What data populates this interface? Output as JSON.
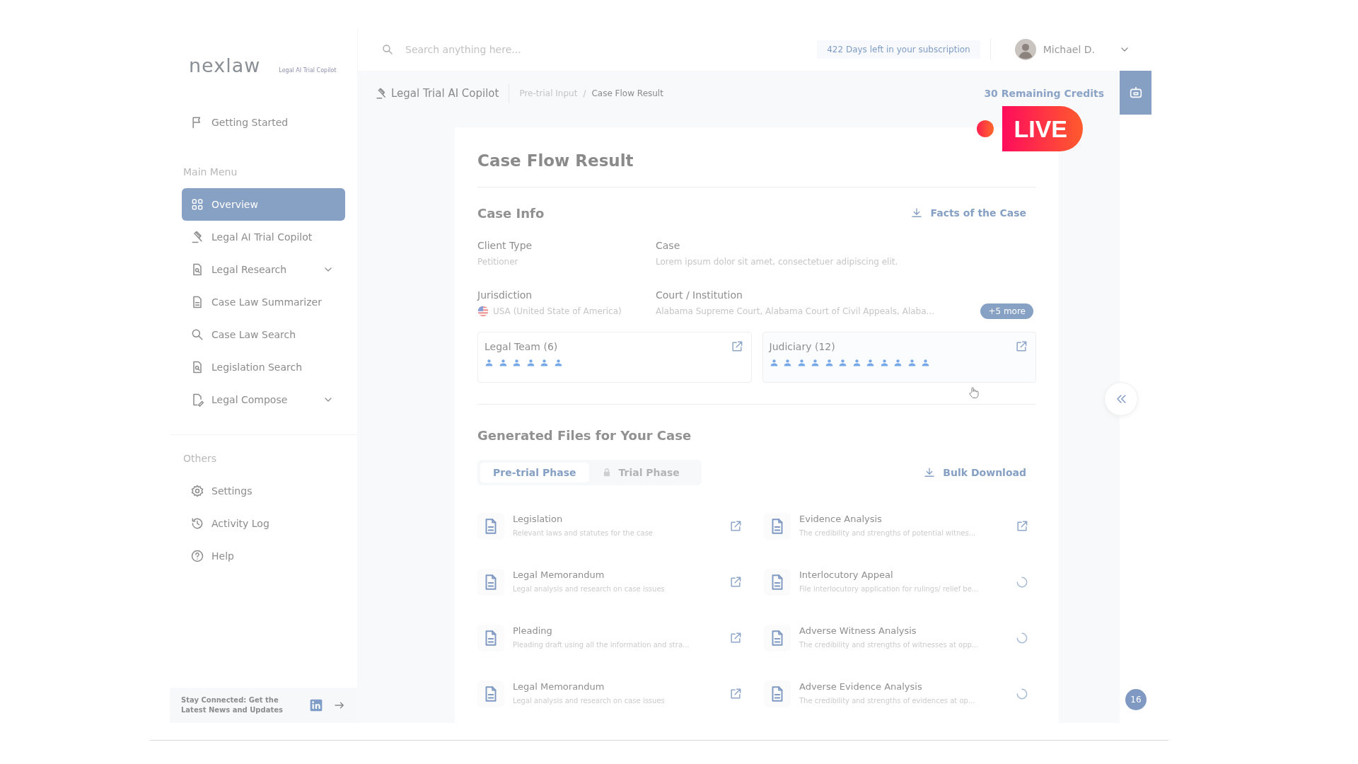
{
  "sidebar": {
    "logo": {
      "name": "nexlaw",
      "tagline": "Legal AI Trial Copilot"
    },
    "top_item": {
      "label": "Getting Started",
      "kind": "flag",
      "selected": false,
      "has_submenu": false
    },
    "sections": [
      {
        "heading": "Main Menu",
        "items": [
          {
            "label": "Overview",
            "kind": "grid",
            "selected": true,
            "has_submenu": false
          },
          {
            "label": "Legal AI Trial Copilot",
            "kind": "gavel",
            "selected": false,
            "has_submenu": false
          },
          {
            "label": "Legal Research",
            "kind": "docsearch",
            "selected": false,
            "has_submenu": true
          },
          {
            "label": "Case Law Summarizer",
            "kind": "doc",
            "selected": false,
            "has_submenu": false
          },
          {
            "label": "Case Law Search",
            "kind": "search",
            "selected": false,
            "has_submenu": false
          },
          {
            "label": "Legislation Search",
            "kind": "docsearch",
            "selected": false,
            "has_submenu": false
          },
          {
            "label": "Legal Compose",
            "kind": "docpen",
            "selected": false,
            "has_submenu": true
          }
        ]
      },
      {
        "heading": "Others",
        "items": [
          {
            "label": "Settings",
            "kind": "gear",
            "selected": false,
            "has_submenu": false
          },
          {
            "label": "Activity Log",
            "kind": "history",
            "selected": false,
            "has_submenu": false
          },
          {
            "label": "Help",
            "kind": "help",
            "selected": false,
            "has_submenu": false
          }
        ]
      }
    ],
    "footer": {
      "text": "Stay Connected: Get the Latest News and Updates"
    }
  },
  "topbar": {
    "search": {
      "placeholder": "Search anything here..."
    },
    "subscription": "422 Days left in your subscription",
    "user": "Michael D."
  },
  "breadcrumb": {
    "title": "Legal Trial AI Copilot",
    "crumbs": [
      {
        "label": "Pre-trial Input",
        "selected": false
      },
      {
        "label": "Case Flow Result",
        "selected": true
      }
    ],
    "separator": "/",
    "credits": "30 Remaining Credits"
  },
  "live_badge": {
    "label": "LIVE"
  },
  "card": {
    "title": "Case Flow Result",
    "case_info": {
      "heading": "Case Info",
      "action": "Facts of the Case",
      "fields": [
        {
          "label": "Client Type",
          "value": "Petitioner",
          "kind": "text"
        },
        {
          "label": "Case",
          "value": "Lorem ipsum dolor sit amet, consectetuer adipiscing elit.",
          "kind": "text"
        },
        {
          "label": "Jurisdiction",
          "value": "USA (United State of America)",
          "kind": "flag"
        },
        {
          "label": "Court / Institution",
          "value": "Alabama Supreme Court, Alabama Court of Civil Appeals, Alaba...",
          "kind": "more",
          "more": "+5 more"
        }
      ],
      "teams": [
        {
          "title": "Legal Team (6)",
          "members": [
            {
              "kind": "person"
            },
            {
              "kind": "person"
            },
            {
              "kind": "person"
            },
            {
              "kind": "person"
            },
            {
              "kind": "person"
            },
            {
              "kind": "person"
            }
          ]
        },
        {
          "title": "Judiciary (12)",
          "members": [
            {
              "kind": "person"
            },
            {
              "kind": "person"
            },
            {
              "kind": "person"
            },
            {
              "kind": "person"
            },
            {
              "kind": "person"
            },
            {
              "kind": "person"
            },
            {
              "kind": "person"
            },
            {
              "kind": "person"
            },
            {
              "kind": "person"
            },
            {
              "kind": "person"
            },
            {
              "kind": "person"
            },
            {
              "kind": "person"
            }
          ]
        }
      ]
    },
    "files": {
      "heading": "Generated Files for Your Case",
      "tabs": [
        {
          "label": "Pre-trial Phase",
          "selected": true,
          "locked": false
        },
        {
          "label": "Trial Phase",
          "selected": false,
          "locked": true
        }
      ],
      "bulk": "Bulk Download",
      "items": [
        {
          "title": "Legislation",
          "description": "Relevant laws and statutes for the case",
          "generating": false
        },
        {
          "title": "Evidence Analysis",
          "description": "The credibility and strengths of potential witnes...",
          "generating": false
        },
        {
          "title": "Legal Memorandum",
          "description": "Legal analysis and research on case issues",
          "generating": false
        },
        {
          "title": "Interlocutory Appeal",
          "description": "File interlocutory application for rulings/ relief be...",
          "generating": true
        },
        {
          "title": "Pleading",
          "description": "Pleading draft using all the information and stra...",
          "generating": false
        },
        {
          "title": "Adverse Witness Analysis",
          "description": "The credibility and strengths of witnesses at opp...",
          "generating": true
        },
        {
          "title": "Legal Memorandum",
          "description": "Legal analysis and research on case issues",
          "generating": false
        },
        {
          "title": "Adverse Evidence Analysis",
          "description": "The credibility and strengths of evidences at op...",
          "generating": true
        }
      ]
    }
  },
  "rail": {
    "badge": "16"
  }
}
